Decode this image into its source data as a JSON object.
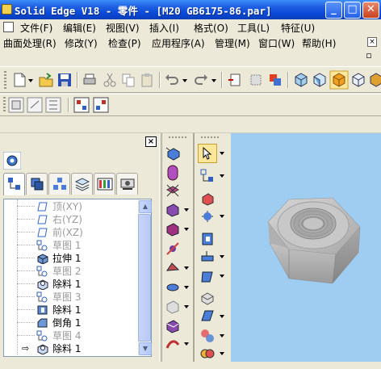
{
  "window": {
    "title": "Solid Edge V18 - 零件 - [M20 GB6175-86.par]",
    "buttons": {
      "minimize": "_",
      "maximize": "□",
      "close": "✕"
    }
  },
  "menus": {
    "row1": [
      {
        "label": "文件(F)",
        "disabled": false
      },
      {
        "label": "编辑(E)",
        "disabled": false
      },
      {
        "label": "视图(V)",
        "disabled": false
      },
      {
        "label": "插入(I)",
        "disabled": false
      },
      {
        "label": "格式(O)",
        "disabled": false
      },
      {
        "label": "工具(L)",
        "disabled": false
      },
      {
        "label": "特征(U)",
        "disabled": false
      }
    ],
    "row2": [
      {
        "label": "曲面处理(R)",
        "disabled": false
      },
      {
        "label": "修改(Y)",
        "disabled": false
      },
      {
        "label": "检查(P)",
        "disabled": false
      },
      {
        "label": "应用程序(A)",
        "disabled": false
      },
      {
        "label": "管理(M)",
        "disabled": false
      },
      {
        "label": "窗口(W)",
        "disabled": false
      },
      {
        "label": "帮助(H)",
        "disabled": false
      }
    ]
  },
  "panel": {
    "close_label": "×",
    "tree": [
      {
        "label": "顶(XY)",
        "icon": "plane-icon",
        "dim": true
      },
      {
        "label": "右(YZ)",
        "icon": "plane-icon",
        "dim": true
      },
      {
        "label": "前(XZ)",
        "icon": "plane-icon",
        "dim": true
      },
      {
        "label": "草图 1",
        "icon": "sketch-icon",
        "dim": true
      },
      {
        "label": "拉伸 1",
        "icon": "extrude-icon",
        "dim": false
      },
      {
        "label": "草图 2",
        "icon": "sketch-icon",
        "dim": true
      },
      {
        "label": "除料 1",
        "icon": "cutout-icon",
        "dim": false
      },
      {
        "label": "草图 3",
        "icon": "sketch-icon",
        "dim": true
      },
      {
        "label": "除料 1",
        "icon": "cutout-icon",
        "dim": false
      },
      {
        "label": "倒角 1",
        "icon": "chamfer-icon",
        "dim": false
      },
      {
        "label": "草图 4",
        "icon": "sketch-icon",
        "dim": true
      },
      {
        "label": "除料 1",
        "icon": "cutout-icon",
        "dim": false
      }
    ]
  },
  "colors": {
    "viewport_bg": "#9fcdf2",
    "title_bar": "#0a48d8",
    "nut": "#b8b8b8"
  }
}
